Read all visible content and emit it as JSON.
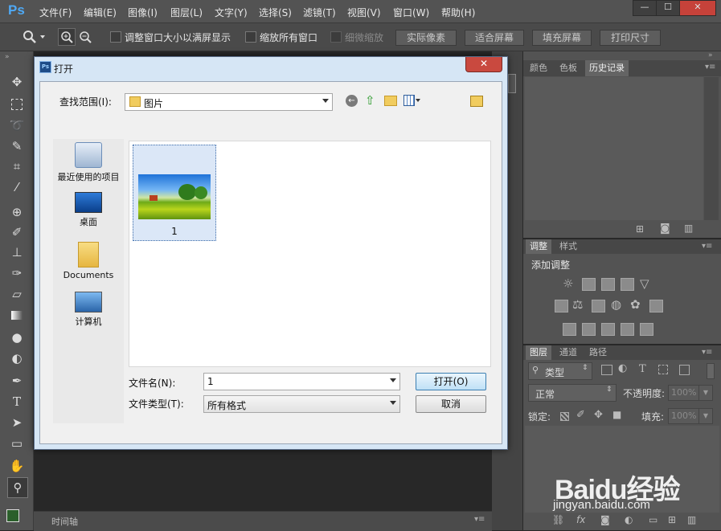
{
  "app": {
    "logo": "Ps"
  },
  "menubar": {
    "items": [
      "文件(F)",
      "编辑(E)",
      "图像(I)",
      "图层(L)",
      "文字(Y)",
      "选择(S)",
      "滤镜(T)",
      "视图(V)",
      "窗口(W)",
      "帮助(H)"
    ],
    "window_buttons": [
      "—",
      "☐",
      "✕"
    ]
  },
  "options": {
    "resize_windows": "调整窗口大小以满屏显示",
    "zoom_all_windows": "缩放所有窗口",
    "scrubby_zoom": "细微缩放",
    "actual_pixels": "实际像素",
    "fit_screen": "适合屏幕",
    "fill_screen": "填充屏幕",
    "print_size": "打印尺寸"
  },
  "tools": [
    "move-tool",
    "marquee-tool",
    "lasso-tool",
    "quick-select-tool",
    "crop-tool",
    "eyedropper-tool",
    "healing-tool",
    "brush-tool",
    "stamp-tool",
    "history-brush-tool",
    "eraser-tool",
    "gradient-tool",
    "blur-tool",
    "dodge-tool",
    "pen-tool",
    "type-tool",
    "path-select-tool",
    "shape-tool",
    "hand-tool",
    "zoom-tool"
  ],
  "timeline": {
    "label": "时间轴"
  },
  "panels": {
    "top_tabs": [
      "颜色",
      "色板",
      "历史记录"
    ],
    "adjust_tabs": [
      "调整",
      "样式"
    ],
    "adjust_title": "添加调整",
    "layers_tabs": [
      "图层",
      "通道",
      "路径"
    ],
    "kind": "类型",
    "blend_mode": "正常",
    "opacity_label": "不透明度:",
    "opacity_value": "100%",
    "lock_label": "锁定:",
    "fill_label": "填充:",
    "fill_value": "100%"
  },
  "dialog": {
    "title": "打开",
    "close": "✕",
    "look_in_label": "查找范围(I):",
    "look_in_value": "图片",
    "places": [
      "最近使用的项目",
      "桌面",
      "Documents",
      "计算机"
    ],
    "files": [
      {
        "name": "1"
      }
    ],
    "filename_label": "文件名(N):",
    "filename_value": "1",
    "filetype_label": "文件类型(T):",
    "filetype_value": "所有格式",
    "open_button": "打开(O)",
    "cancel_button": "取消"
  },
  "watermark": {
    "brand": "Baidu经验",
    "url": "jingyan.baidu.com"
  }
}
